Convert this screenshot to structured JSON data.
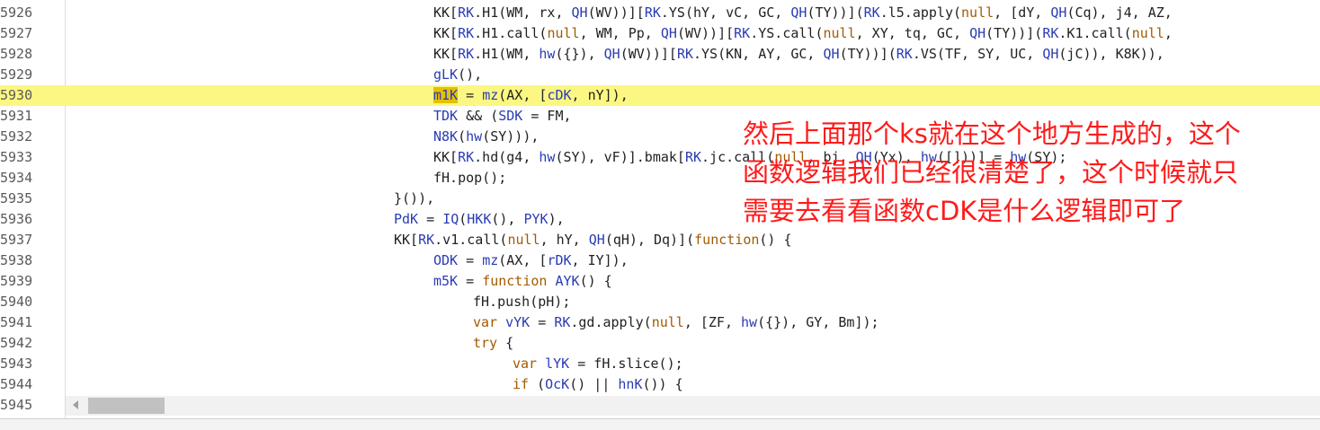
{
  "editor": {
    "lines": [
      {
        "num": "5926",
        "tokens": [
          {
            "t": "KK[",
            "c": "plain"
          },
          {
            "t": "RK",
            "c": "prop"
          },
          {
            "t": ".H1(WM, rx, ",
            "c": "plain"
          },
          {
            "t": "QH",
            "c": "prop"
          },
          {
            "t": "(WV))][",
            "c": "plain"
          },
          {
            "t": "RK",
            "c": "prop"
          },
          {
            "t": ".YS(hY, vC, GC, ",
            "c": "plain"
          },
          {
            "t": "QH",
            "c": "prop"
          },
          {
            "t": "(TY))](",
            "c": "plain"
          },
          {
            "t": "RK",
            "c": "prop"
          },
          {
            "t": ".l5.apply(",
            "c": "plain"
          },
          {
            "t": "null",
            "c": "kw"
          },
          {
            "t": ", [dY, ",
            "c": "plain"
          },
          {
            "t": "QH",
            "c": "prop"
          },
          {
            "t": "(Cq), j4, AZ,",
            "c": "plain"
          }
        ]
      },
      {
        "num": "5927",
        "tokens": [
          {
            "t": "KK[",
            "c": "plain"
          },
          {
            "t": "RK",
            "c": "prop"
          },
          {
            "t": ".H1.call(",
            "c": "plain"
          },
          {
            "t": "null",
            "c": "kw"
          },
          {
            "t": ", WM, Pp, ",
            "c": "plain"
          },
          {
            "t": "QH",
            "c": "prop"
          },
          {
            "t": "(WV))][",
            "c": "plain"
          },
          {
            "t": "RK",
            "c": "prop"
          },
          {
            "t": ".YS.call(",
            "c": "plain"
          },
          {
            "t": "null",
            "c": "kw"
          },
          {
            "t": ", XY, tq, GC, ",
            "c": "plain"
          },
          {
            "t": "QH",
            "c": "prop"
          },
          {
            "t": "(TY))](",
            "c": "plain"
          },
          {
            "t": "RK",
            "c": "prop"
          },
          {
            "t": ".K1.call(",
            "c": "plain"
          },
          {
            "t": "null",
            "c": "kw"
          },
          {
            "t": ",",
            "c": "plain"
          }
        ]
      },
      {
        "num": "5928",
        "tokens": [
          {
            "t": "KK[",
            "c": "plain"
          },
          {
            "t": "RK",
            "c": "prop"
          },
          {
            "t": ".H1(WM, ",
            "c": "plain"
          },
          {
            "t": "hw",
            "c": "prop"
          },
          {
            "t": "({}), ",
            "c": "plain"
          },
          {
            "t": "QH",
            "c": "prop"
          },
          {
            "t": "(WV))][",
            "c": "plain"
          },
          {
            "t": "RK",
            "c": "prop"
          },
          {
            "t": ".YS(KN, AY, GC, ",
            "c": "plain"
          },
          {
            "t": "QH",
            "c": "prop"
          },
          {
            "t": "(TY))](",
            "c": "plain"
          },
          {
            "t": "RK",
            "c": "prop"
          },
          {
            "t": ".VS(TF, SY, UC, ",
            "c": "plain"
          },
          {
            "t": "QH",
            "c": "prop"
          },
          {
            "t": "(jC)), K8K)),",
            "c": "plain"
          }
        ]
      },
      {
        "num": "5929",
        "tokens": [
          {
            "t": "gLK",
            "c": "prop"
          },
          {
            "t": "(),",
            "c": "plain"
          }
        ]
      },
      {
        "num": "5930",
        "tokens": [
          {
            "t": "m1K",
            "c": "hlword"
          },
          {
            "t": " = ",
            "c": "plain"
          },
          {
            "t": "mz",
            "c": "prop"
          },
          {
            "t": "(AX, [",
            "c": "plain"
          },
          {
            "t": "cDK",
            "c": "prop"
          },
          {
            "t": ", nY]),",
            "c": "plain"
          }
        ]
      },
      {
        "num": "5931",
        "tokens": [
          {
            "t": "TDK",
            "c": "prop"
          },
          {
            "t": " && (",
            "c": "plain"
          },
          {
            "t": "SDK",
            "c": "prop"
          },
          {
            "t": " = FM,",
            "c": "plain"
          }
        ]
      },
      {
        "num": "5932",
        "tokens": [
          {
            "t": "N8K",
            "c": "prop"
          },
          {
            "t": "(",
            "c": "plain"
          },
          {
            "t": "hw",
            "c": "prop"
          },
          {
            "t": "(SY))),",
            "c": "plain"
          }
        ]
      },
      {
        "num": "5933",
        "tokens": [
          {
            "t": "KK[",
            "c": "plain"
          },
          {
            "t": "RK",
            "c": "prop"
          },
          {
            "t": ".hd(g4, ",
            "c": "plain"
          },
          {
            "t": "hw",
            "c": "prop"
          },
          {
            "t": "(SY), vF)].bmak[",
            "c": "plain"
          },
          {
            "t": "RK",
            "c": "prop"
          },
          {
            "t": ".jc.call(",
            "c": "plain"
          },
          {
            "t": "null",
            "c": "kw"
          },
          {
            "t": ", bj, ",
            "c": "plain"
          },
          {
            "t": "QH",
            "c": "prop"
          },
          {
            "t": "(Yx), ",
            "c": "plain"
          },
          {
            "t": "hw",
            "c": "prop"
          },
          {
            "t": "([]))] = ",
            "c": "plain"
          },
          {
            "t": "hw",
            "c": "prop"
          },
          {
            "t": "(SY);",
            "c": "plain"
          }
        ]
      },
      {
        "num": "5934",
        "tokens": [
          {
            "t": "fH.pop();",
            "c": "plain"
          }
        ]
      },
      {
        "num": "5935",
        "tokens": [
          {
            "t": "}()),",
            "c": "plain"
          }
        ]
      },
      {
        "num": "5936",
        "tokens": [
          {
            "t": "PdK",
            "c": "prop"
          },
          {
            "t": " = ",
            "c": "plain"
          },
          {
            "t": "IQ",
            "c": "prop"
          },
          {
            "t": "(",
            "c": "plain"
          },
          {
            "t": "HKK",
            "c": "prop"
          },
          {
            "t": "(), ",
            "c": "plain"
          },
          {
            "t": "PYK",
            "c": "prop"
          },
          {
            "t": "),",
            "c": "plain"
          }
        ]
      },
      {
        "num": "5937",
        "tokens": [
          {
            "t": "KK[",
            "c": "plain"
          },
          {
            "t": "RK",
            "c": "prop"
          },
          {
            "t": ".v1.call(",
            "c": "plain"
          },
          {
            "t": "null",
            "c": "kw"
          },
          {
            "t": ", hY, ",
            "c": "plain"
          },
          {
            "t": "QH",
            "c": "prop"
          },
          {
            "t": "(qH), Dq)](",
            "c": "plain"
          },
          {
            "t": "function",
            "c": "kw"
          },
          {
            "t": "() {",
            "c": "plain"
          }
        ]
      },
      {
        "num": "5938",
        "tokens": [
          {
            "t": "ODK",
            "c": "prop"
          },
          {
            "t": " = ",
            "c": "plain"
          },
          {
            "t": "mz",
            "c": "prop"
          },
          {
            "t": "(AX, [",
            "c": "plain"
          },
          {
            "t": "rDK",
            "c": "prop"
          },
          {
            "t": ", IY]),",
            "c": "plain"
          }
        ]
      },
      {
        "num": "5939",
        "tokens": [
          {
            "t": "m5K",
            "c": "prop"
          },
          {
            "t": " = ",
            "c": "plain"
          },
          {
            "t": "function",
            "c": "kw"
          },
          {
            "t": " ",
            "c": "plain"
          },
          {
            "t": "AYK",
            "c": "prop"
          },
          {
            "t": "() {",
            "c": "plain"
          }
        ]
      },
      {
        "num": "5940",
        "tokens": [
          {
            "t": "fH.push(pH);",
            "c": "plain"
          }
        ]
      },
      {
        "num": "5941",
        "tokens": [
          {
            "t": "var",
            "c": "kw"
          },
          {
            "t": " ",
            "c": "plain"
          },
          {
            "t": "vYK",
            "c": "prop"
          },
          {
            "t": " = ",
            "c": "plain"
          },
          {
            "t": "RK",
            "c": "prop"
          },
          {
            "t": ".gd.apply(",
            "c": "plain"
          },
          {
            "t": "null",
            "c": "kw"
          },
          {
            "t": ", [ZF, ",
            "c": "plain"
          },
          {
            "t": "hw",
            "c": "prop"
          },
          {
            "t": "({}), GY, Bm]);",
            "c": "plain"
          }
        ]
      },
      {
        "num": "5942",
        "tokens": [
          {
            "t": "try",
            "c": "kw"
          },
          {
            "t": " {",
            "c": "plain"
          }
        ]
      },
      {
        "num": "5943",
        "tokens": [
          {
            "t": "var",
            "c": "kw"
          },
          {
            "t": " ",
            "c": "plain"
          },
          {
            "t": "lYK",
            "c": "prop"
          },
          {
            "t": " = fH.slice();",
            "c": "plain"
          }
        ]
      },
      {
        "num": "5944",
        "tokens": [
          {
            "t": "if",
            "c": "kw"
          },
          {
            "t": " (",
            "c": "plain"
          },
          {
            "t": "OcK",
            "c": "prop"
          },
          {
            "t": "() || ",
            "c": "plain"
          },
          {
            "t": "hnK",
            "c": "prop"
          },
          {
            "t": "()) {",
            "c": "plain"
          }
        ]
      },
      {
        "num": "5945",
        "tokens": []
      }
    ],
    "highlighted_line": "5930"
  },
  "annotation": {
    "text": "然后上面那个ks就在这个地方生成的，这个\n函数逻辑我们已经很清楚了，这个时候就只\n需要去看看函数cDK是什么逻辑即可了",
    "color": "#ff1a1a"
  },
  "colors": {
    "highlight_bg": "#fbf782",
    "identifier": "#2a3cb3",
    "keyword": "#a35a00"
  }
}
